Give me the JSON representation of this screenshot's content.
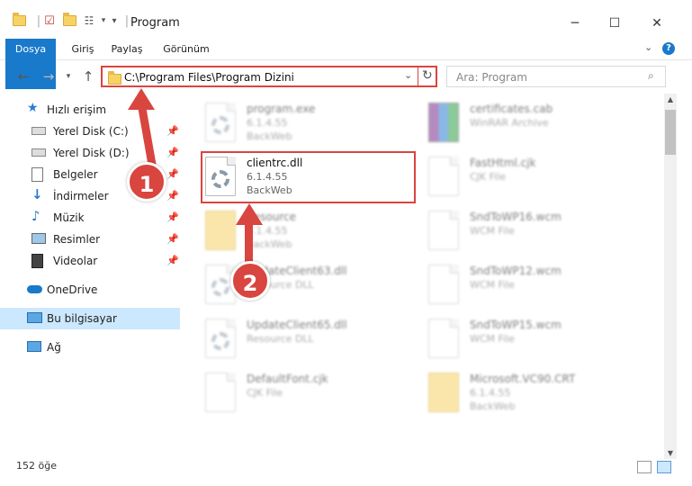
{
  "window": {
    "title": "Program",
    "minimize": "─",
    "maximize": "☐",
    "close": "✕"
  },
  "ribbon": {
    "tabs": [
      "Dosya",
      "Giriş",
      "Paylaş",
      "Görünüm"
    ],
    "help": "?"
  },
  "address": {
    "path": "C:\\Program Files\\Program Dizini",
    "search_placeholder": "Ara: Program"
  },
  "sidebar": {
    "items": [
      {
        "label": "Hızlı erişim",
        "icon": "star-icon",
        "pinned": false
      },
      {
        "label": "Yerel Disk (C:)",
        "icon": "drive-icon",
        "pinned": true
      },
      {
        "label": "Yerel Disk (D:)",
        "icon": "drive-icon",
        "pinned": true
      },
      {
        "label": "Belgeler",
        "icon": "documents-icon",
        "pinned": true
      },
      {
        "label": "İndirmeler",
        "icon": "download-icon",
        "pinned": true
      },
      {
        "label": "Müzik",
        "icon": "music-icon",
        "pinned": true
      },
      {
        "label": "Resimler",
        "icon": "pictures-icon",
        "pinned": true
      },
      {
        "label": "Videolar",
        "icon": "video-icon",
        "pinned": true
      },
      {
        "label": "OneDrive",
        "icon": "cloud-icon",
        "pinned": false
      },
      {
        "label": "Bu bilgisayar",
        "icon": "computer-icon",
        "pinned": false,
        "selected": true
      },
      {
        "label": "Ağ",
        "icon": "network-icon",
        "pinned": false
      }
    ]
  },
  "files": [
    {
      "name": "program.exe",
      "line2": "6.1.4.55",
      "line3": "BackWeb",
      "icon": "exe-icon"
    },
    {
      "name": "certificates.cab",
      "line2": "WinRAR Archive",
      "line3": "",
      "icon": "archive-icon"
    },
    {
      "name": "clientrc.dll",
      "line2": "6.1.4.55",
      "line3": "BackWeb",
      "icon": "dll-icon",
      "highlighted": true
    },
    {
      "name": "FastHtml.cjk",
      "line2": "CJK File",
      "line3": "",
      "icon": "file-icon"
    },
    {
      "name": "Resource",
      "line2": "6.1.4.55",
      "line3": "BackWeb",
      "icon": "folder-icon"
    },
    {
      "name": "SndToWP16.wcm",
      "line2": "WCM File",
      "line3": "",
      "icon": "file-icon"
    },
    {
      "name": "UpdateClient63.dll",
      "line2": "Resource DLL",
      "line3": "",
      "icon": "dll-icon"
    },
    {
      "name": "SndToWP12.wcm",
      "line2": "WCM File",
      "line3": "",
      "icon": "file-icon"
    },
    {
      "name": "UpdateClient65.dll",
      "line2": "Resource DLL",
      "line3": "",
      "icon": "dll-icon"
    },
    {
      "name": "SndToWP15.wcm",
      "line2": "WCM File",
      "line3": "",
      "icon": "file-icon"
    },
    {
      "name": "DefaultFont.cjk",
      "line2": "CJK File",
      "line3": "",
      "icon": "file-icon"
    },
    {
      "name": "Microsoft.VC90.CRT",
      "line2": "6.1.4.55",
      "line3": "BackWeb",
      "icon": "folder-icon"
    }
  ],
  "status": {
    "count": "152 öğe"
  },
  "callouts": [
    "1",
    "2"
  ],
  "colors": {
    "accent": "#1979ca",
    "highlight": "#d9453f",
    "selection": "#cce8ff"
  }
}
